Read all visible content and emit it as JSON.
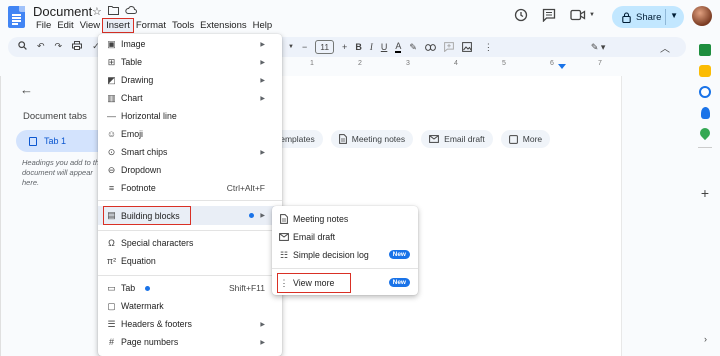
{
  "app": {
    "title": "Document",
    "menubar": [
      "File",
      "Edit",
      "View",
      "Insert",
      "Format",
      "Tools",
      "Extensions",
      "Help"
    ],
    "selected_menu": "Insert",
    "share_label": "Share"
  },
  "toolbar": {
    "font_size": "11"
  },
  "ruler": {
    "ticks": [
      "1",
      "2",
      "3",
      "4",
      "5",
      "6",
      "7"
    ]
  },
  "sidebar": {
    "title": "Document tabs",
    "tab_label": "Tab 1",
    "hint": "Headings you add to the document will appear here."
  },
  "chips": [
    "Templates",
    "Meeting notes",
    "Email draft",
    "More"
  ],
  "insert_menu": {
    "items": [
      {
        "label": "Image",
        "icon": "image-icon",
        "has_submenu": true
      },
      {
        "label": "Table",
        "icon": "table-icon",
        "has_submenu": true
      },
      {
        "label": "Drawing",
        "icon": "drawing-icon",
        "has_submenu": true
      },
      {
        "label": "Chart",
        "icon": "chart-icon",
        "has_submenu": true
      },
      {
        "label": "Horizontal line",
        "icon": "horizontal-line-icon"
      },
      {
        "label": "Emoji",
        "icon": "emoji-icon"
      },
      {
        "label": "Smart chips",
        "icon": "smart-chips-icon",
        "has_submenu": true
      },
      {
        "label": "Dropdown",
        "icon": "dropdown-icon"
      },
      {
        "label": "Footnote",
        "icon": "footnote-icon",
        "shortcut": "Ctrl+Alt+F"
      },
      {
        "label": "Building blocks",
        "icon": "building-blocks-icon",
        "has_submenu": true,
        "new_dot": true,
        "highlighted": true
      },
      {
        "label": "Special characters",
        "icon": "omega-icon"
      },
      {
        "label": "Equation",
        "icon": "equation-icon"
      },
      {
        "label": "Tab",
        "icon": "tab-icon",
        "shortcut": "Shift+F11",
        "new_dot": true
      },
      {
        "label": "Watermark",
        "icon": "watermark-icon"
      },
      {
        "label": "Headers & footers",
        "icon": "headers-footers-icon",
        "has_submenu": true
      },
      {
        "label": "Page numbers",
        "icon": "page-numbers-icon",
        "has_submenu": true
      }
    ]
  },
  "building_blocks_submenu": {
    "items": [
      {
        "label": "Meeting notes",
        "icon": "meeting-notes-icon"
      },
      {
        "label": "Email draft",
        "icon": "email-draft-icon"
      },
      {
        "label": "Simple decision log",
        "icon": "decision-log-icon",
        "badge": "New"
      },
      {
        "label": "View more",
        "icon": "more-vert-icon",
        "badge": "New"
      }
    ]
  }
}
